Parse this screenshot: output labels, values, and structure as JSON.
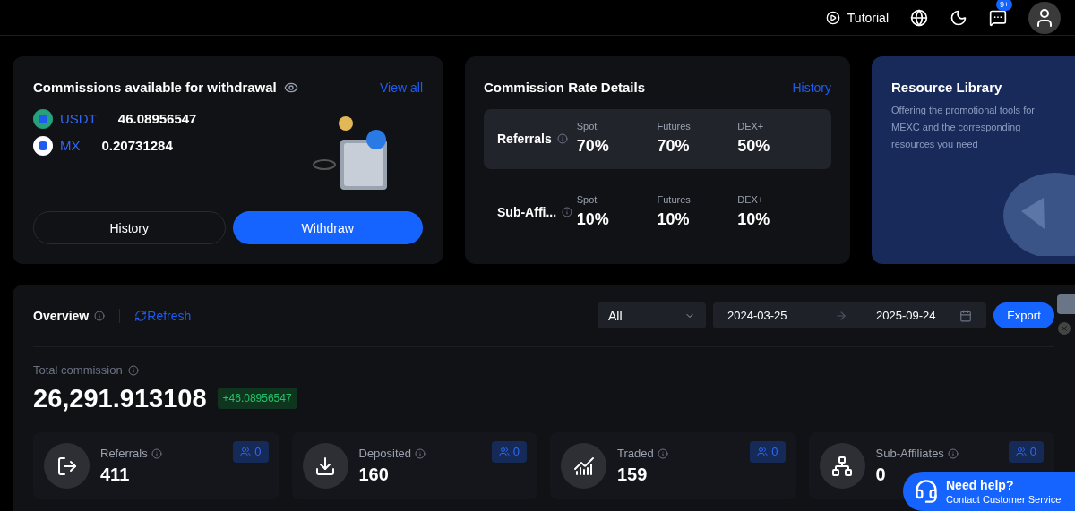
{
  "header": {
    "tutorial": "Tutorial",
    "notification_badge": "9+"
  },
  "withdrawal_card": {
    "title": "Commissions available for withdrawal",
    "view_all": "View all",
    "assets": [
      {
        "symbol": "USDT",
        "amount": "46.08956547",
        "color": "#26a17b"
      },
      {
        "symbol": "MX",
        "amount": "0.20731284",
        "color": "#ffffff"
      }
    ],
    "buttons": [
      {
        "label": "History",
        "kind": "secondary"
      },
      {
        "label": "Withdraw",
        "kind": "primary"
      }
    ]
  },
  "rate_card": {
    "title": "Commission Rate Details",
    "history": "History",
    "rows": [
      {
        "label": "Referrals",
        "highlighted": true,
        "rates": [
          {
            "name": "Spot",
            "value": "70%"
          },
          {
            "name": "Futures",
            "value": "70%"
          },
          {
            "name": "DEX+",
            "value": "50%"
          }
        ]
      },
      {
        "label": "Sub-Affi...",
        "highlighted": false,
        "rates": [
          {
            "name": "Spot",
            "value": "10%"
          },
          {
            "name": "Futures",
            "value": "10%"
          },
          {
            "name": "DEX+",
            "value": "10%"
          }
        ]
      }
    ]
  },
  "resource_card": {
    "title": "Resource Library",
    "description": "Offering the promotional tools for MEXC and the corresponding resources you need"
  },
  "overview": {
    "title": "Overview",
    "refresh": "Refresh",
    "filter": "All",
    "date_from": "2024-03-25",
    "date_to": "2025-09-24",
    "export": "Export",
    "total_label": "Total commission",
    "total": "26,291.913108",
    "change": "+46.08956547",
    "stats": [
      {
        "label": "Referrals",
        "value": "411",
        "count": "0",
        "kind": "referrals"
      },
      {
        "label": "Deposited",
        "value": "160",
        "count": "0",
        "kind": "deposited"
      },
      {
        "label": "Traded",
        "value": "159",
        "count": "0",
        "kind": "traded"
      },
      {
        "label": "Sub-Affiliates",
        "value": "0",
        "count": "0",
        "kind": "sub"
      }
    ]
  },
  "help": {
    "title": "Need help?",
    "subtitle": "Contact Customer Service"
  }
}
